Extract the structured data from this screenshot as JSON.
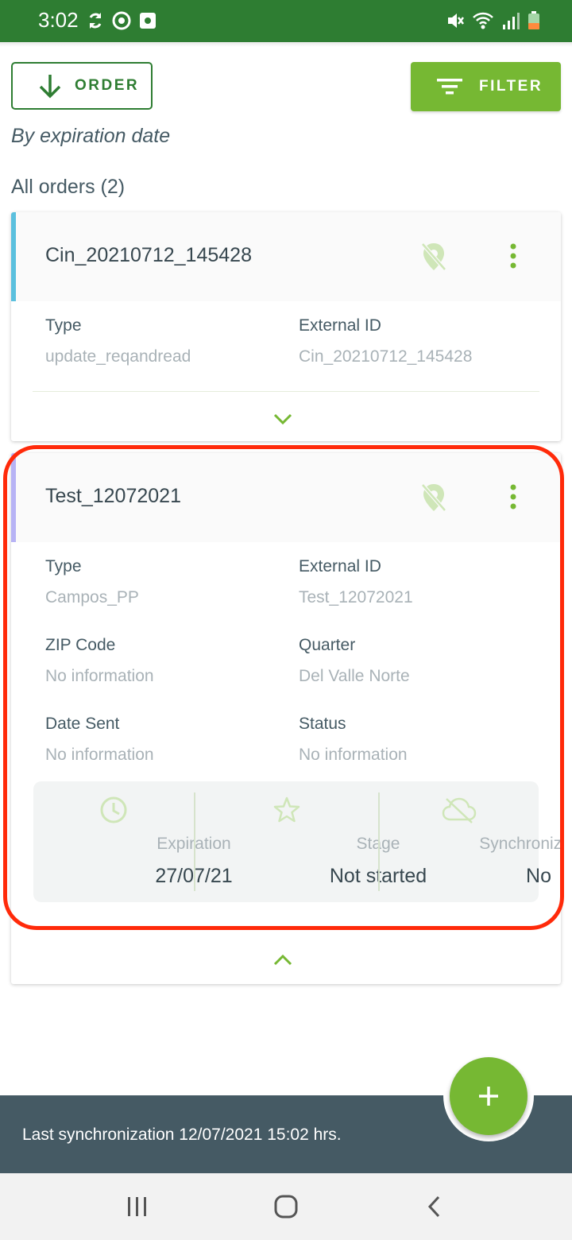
{
  "status_bar": {
    "time": "3:02"
  },
  "toolbar": {
    "order_label": "ORDER",
    "filter_label": "FILTER",
    "sort_description": "By expiration date"
  },
  "list": {
    "heading": "All orders (2)",
    "orders": [
      {
        "title": "Cin_20210712_145428",
        "accent_color": "#5bc0de",
        "fields": {
          "type_label": "Type",
          "type_value": "update_reqandread",
          "external_id_label": "External ID",
          "external_id_value": "Cin_20210712_145428"
        },
        "expanded": false
      },
      {
        "title": "Test_12072021",
        "accent_color": "#b7b3f5",
        "fields": {
          "type_label": "Type",
          "type_value": "Campos_PP",
          "external_id_label": "External ID",
          "external_id_value": "Test_12072021",
          "zip_label": "ZIP Code",
          "zip_value": "No information",
          "quarter_label": "Quarter",
          "quarter_value": "Del Valle Norte",
          "date_sent_label": "Date Sent",
          "date_sent_value": "No information",
          "status_label": "Status",
          "status_value": "No information"
        },
        "summary": {
          "expiration_label": "Expiration",
          "expiration_value": "27/07/21",
          "stage_label": "Stage",
          "stage_value": "Not started",
          "sync_label": "Synchronization",
          "sync_value": "No"
        },
        "expanded": true
      }
    ]
  },
  "footer": {
    "last_sync": "Last synchronization 12/07/2021 15:02 hrs."
  },
  "colors": {
    "primary_dark": "#2e7d32",
    "accent_green": "#76b833",
    "footer_bg": "#455a64",
    "highlight": "#ff2a0a"
  },
  "icons": [
    "sync-icon",
    "target-icon",
    "app-icon",
    "mute-icon",
    "wifi-icon",
    "signal-icon",
    "battery-icon",
    "arrow-down-icon",
    "filter-icon",
    "location-off-icon",
    "more-vert-icon",
    "chevron-down-icon",
    "chevron-up-icon",
    "clock-icon",
    "star-icon",
    "cloud-off-icon",
    "plus-icon",
    "recents-icon",
    "home-icon",
    "back-icon"
  ]
}
